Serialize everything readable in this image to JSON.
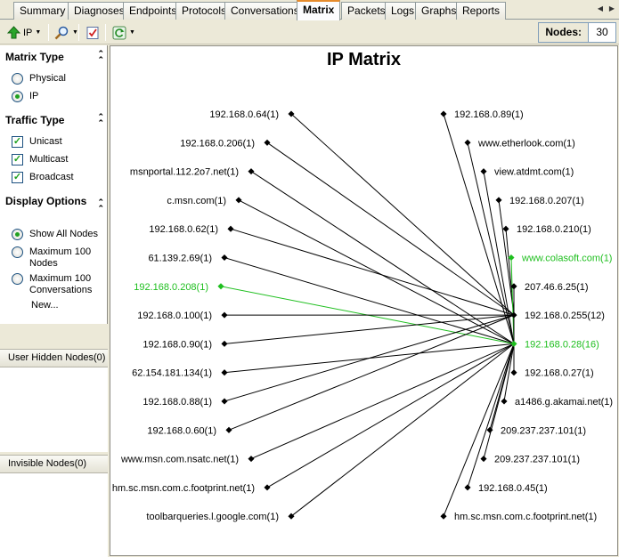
{
  "tabs": [
    {
      "label": "Summary"
    },
    {
      "label": "Diagnoses"
    },
    {
      "label": "Endpoints"
    },
    {
      "label": "Protocols"
    },
    {
      "label": "Conversations"
    },
    {
      "label": "Matrix"
    },
    {
      "label": "Packets"
    },
    {
      "label": "Logs"
    },
    {
      "label": "Graphs"
    },
    {
      "label": "Reports"
    }
  ],
  "active_tab": "Matrix",
  "toolbar": {
    "type_button_label": "IP",
    "nodes_label": "Nodes:",
    "nodes_value": "30"
  },
  "left_panel": {
    "matrix_type": {
      "title": "Matrix Type",
      "options": [
        {
          "label": "Physical",
          "selected": false
        },
        {
          "label": "IP",
          "selected": true
        }
      ]
    },
    "traffic_type": {
      "title": "Traffic Type",
      "options": [
        {
          "label": "Unicast",
          "checked": true
        },
        {
          "label": "Multicast",
          "checked": true
        },
        {
          "label": "Broadcast",
          "checked": true
        }
      ]
    },
    "display_options": {
      "title": "Display Options",
      "options": [
        {
          "label": "Show All Nodes",
          "selected": true
        },
        {
          "label": "Maximum 100 Nodes",
          "selected": false
        },
        {
          "label": "Maximum 100 Conversations",
          "selected": false
        }
      ],
      "new_label": "New..."
    },
    "user_hidden_nodes": "User Hidden Nodes(0)",
    "invisible_nodes": "Invisible Nodes(0)"
  },
  "matrix": {
    "title": "IP Matrix",
    "colors": {
      "normal_line": "#000000",
      "highlight": "#1fbf1f"
    },
    "hubs": [
      "192.168.0.255(12)",
      "192.168.0.28(16)"
    ],
    "highlighted_nodes": [
      "192.168.0.28(16)",
      "192.168.0.208(1)",
      "www.colasoft.com(1)"
    ],
    "left_nodes": [
      "192.168.0.64(1)",
      "192.168.0.206(1)",
      "msnportal.112.2o7.net(1)",
      "c.msn.com(1)",
      "192.168.0.62(1)",
      "61.139.2.69(1)",
      "192.168.0.208(1)",
      "192.168.0.100(1)",
      "192.168.0.90(1)",
      "62.154.181.134(1)",
      "192.168.0.88(1)",
      "192.168.0.60(1)",
      "www.msn.com.nsatc.net(1)",
      "hm.sc.msn.com.c.footprint.net(1)",
      "toolbarqueries.l.google.com(1)"
    ],
    "right_nodes": [
      "192.168.0.89(1)",
      "www.etherlook.com(1)",
      "view.atdmt.com(1)",
      "192.168.0.207(1)",
      "192.168.0.210(1)",
      "www.colasoft.com(1)",
      "207.46.6.25(1)",
      "192.168.0.255(12)",
      "192.168.0.28(16)",
      "192.168.0.27(1)",
      "a1486.g.akamai.net(1)",
      "209.237.237.101(1)",
      "209.237.237.101(1)",
      "192.168.0.45(1)",
      "hm.sc.msn.com.c.footprint.net(1)"
    ],
    "connections": [
      {
        "from": "192.168.0.64(1)",
        "to": "192.168.0.255(12)"
      },
      {
        "from": "192.168.0.206(1)",
        "to": "192.168.0.255(12)"
      },
      {
        "from": "msnportal.112.2o7.net(1)",
        "to": "192.168.0.28(16)"
      },
      {
        "from": "c.msn.com(1)",
        "to": "192.168.0.28(16)"
      },
      {
        "from": "192.168.0.62(1)",
        "to": "192.168.0.255(12)"
      },
      {
        "from": "61.139.2.69(1)",
        "to": "192.168.0.28(16)"
      },
      {
        "from": "192.168.0.208(1)",
        "to": "192.168.0.28(16)",
        "highlight": true
      },
      {
        "from": "192.168.0.100(1)",
        "to": "192.168.0.255(12)"
      },
      {
        "from": "192.168.0.90(1)",
        "to": "192.168.0.255(12)"
      },
      {
        "from": "62.154.181.134(1)",
        "to": "192.168.0.28(16)"
      },
      {
        "from": "192.168.0.88(1)",
        "to": "192.168.0.255(12)"
      },
      {
        "from": "192.168.0.60(1)",
        "to": "192.168.0.255(12)"
      },
      {
        "from": "www.msn.com.nsatc.net(1)",
        "to": "192.168.0.28(16)"
      },
      {
        "from": "hm.sc.msn.com.c.footprint.net(1)",
        "to": "192.168.0.28(16)",
        "side": "left"
      },
      {
        "from": "toolbarqueries.l.google.com(1)",
        "to": "192.168.0.28(16)"
      },
      {
        "from": "192.168.0.89(1)",
        "to": "192.168.0.28(16)"
      },
      {
        "from": "www.etherlook.com(1)",
        "to": "192.168.0.28(16)"
      },
      {
        "from": "view.atdmt.com(1)",
        "to": "192.168.0.28(16)"
      },
      {
        "from": "192.168.0.207(1)",
        "to": "192.168.0.255(12)"
      },
      {
        "from": "192.168.0.210(1)",
        "to": "192.168.0.255(12)"
      },
      {
        "from": "www.colasoft.com(1)",
        "to": "192.168.0.28(16)",
        "highlight": true
      },
      {
        "from": "207.46.6.25(1)",
        "to": "192.168.0.255(12)"
      },
      {
        "from": "192.168.0.255(12)",
        "to": "192.168.0.28(16)"
      },
      {
        "from": "192.168.0.27(1)",
        "to": "192.168.0.255(12)"
      },
      {
        "from": "a1486.g.akamai.net(1)",
        "to": "192.168.0.28(16)"
      },
      {
        "from": "209.237.237.101(1)",
        "to": "192.168.0.28(16)",
        "index": 11
      },
      {
        "from": "209.237.237.101(1)",
        "to": "192.168.0.28(16)",
        "index": 12
      },
      {
        "from": "192.168.0.45(1)",
        "to": "192.168.0.28(16)"
      },
      {
        "from": "hm.sc.msn.com.c.footprint.net(1)",
        "to": "192.168.0.28(16)",
        "side": "right"
      }
    ]
  }
}
